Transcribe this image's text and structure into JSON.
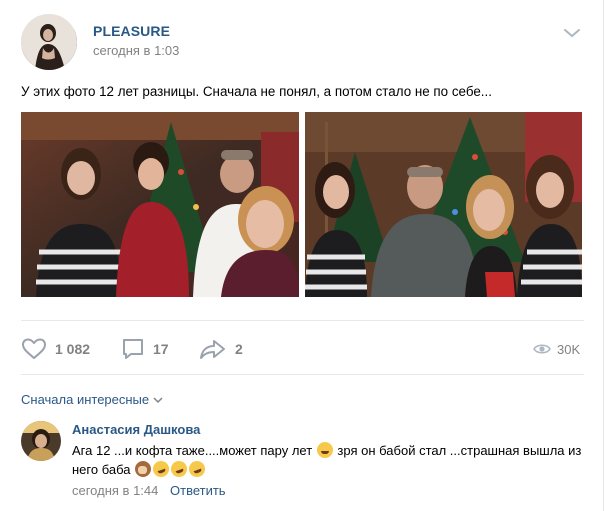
{
  "post": {
    "author": "PLEASURE",
    "time": "сегодня в 1:03",
    "text": "У этих фото 12 лет разницы. Сначала не понял, а потом стало не по себе...",
    "photos": [
      "family-photo-left",
      "family-photo-right"
    ]
  },
  "actions": {
    "likes": "1 082",
    "comments": "17",
    "shares": "2",
    "views": "30K"
  },
  "comments_section": {
    "sort_label": "Сначала интересные",
    "comment": {
      "author": "Анастасия Дашкова",
      "text_part1": "Ага 12 ...и кофта таже....может пару лет",
      "text_part2": "зря он бабой стал ...страшная вышла из него баба",
      "time": "сегодня в 1:44",
      "reply_label": "Ответить"
    }
  },
  "colors": {
    "link": "#2a5885",
    "muted": "#828282",
    "divider": "#e7e8ec"
  },
  "icons": [
    "chevron-down-icon",
    "heart-icon",
    "comment-icon",
    "share-icon",
    "eye-icon",
    "thinking-emoji",
    "see-no-evil-emoji",
    "rofl-emoji"
  ]
}
